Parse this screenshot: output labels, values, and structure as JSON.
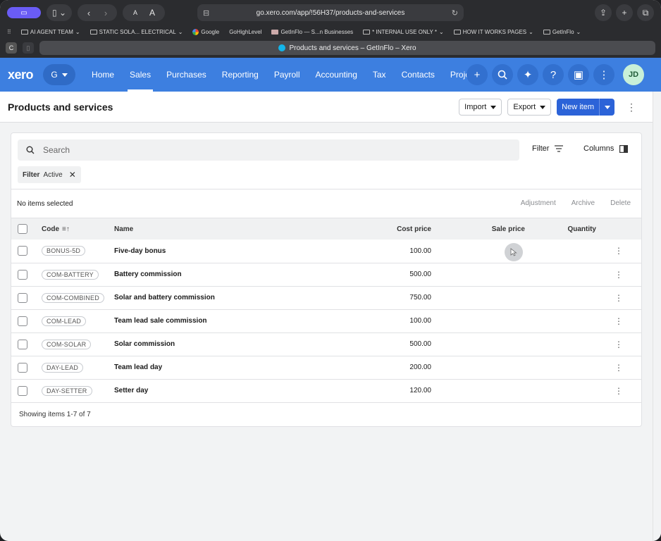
{
  "browser": {
    "url": "go.xero.com/app/!56H37/products-and-services",
    "tab_title": "Products and services – GetInFlo – Xero",
    "tab_badge": "C",
    "bookmarks": [
      {
        "label": "AI AGENT TEAM",
        "type": "folder"
      },
      {
        "label": "STATIC SOLA... ELECTRICAL",
        "type": "folder"
      },
      {
        "label": "Google",
        "type": "google"
      },
      {
        "label": "GoHighLevel",
        "type": "link"
      },
      {
        "label": "GetInFlo — S...n Businesses",
        "type": "link"
      },
      {
        "label": "* INTERNAL USE ONLY *",
        "type": "folder"
      },
      {
        "label": "HOW IT WORKS PAGES",
        "type": "folder"
      },
      {
        "label": "GetInFlo",
        "type": "folder"
      }
    ]
  },
  "xero": {
    "logo": "xero",
    "org_initial": "G",
    "nav": [
      "Home",
      "Sales",
      "Purchases",
      "Reporting",
      "Payroll",
      "Accounting",
      "Tax",
      "Contacts",
      "Projects"
    ],
    "active_nav": "Sales",
    "avatar_initials": "JD"
  },
  "page": {
    "title": "Products and services",
    "import_label": "Import",
    "export_label": "Export",
    "new_item_label": "New item"
  },
  "toolbar": {
    "search_placeholder": "Search",
    "filter_label": "Filter",
    "columns_label": "Columns",
    "chip_key": "Filter",
    "chip_value": "Active"
  },
  "selection": {
    "text": "No items selected",
    "actions": [
      "Adjustment",
      "Archive",
      "Delete"
    ]
  },
  "table": {
    "headers": {
      "code": "Code",
      "name": "Name",
      "cost": "Cost price",
      "sale": "Sale price",
      "qty": "Quantity"
    },
    "rows": [
      {
        "code": "BONUS-5D",
        "name": "Five-day bonus",
        "cost": "100.00",
        "sale": "",
        "qty": ""
      },
      {
        "code": "COM-BATTERY",
        "name": "Battery commission",
        "cost": "500.00",
        "sale": "",
        "qty": ""
      },
      {
        "code": "COM-COMBINED",
        "name": "Solar and battery commission",
        "cost": "750.00",
        "sale": "",
        "qty": ""
      },
      {
        "code": "COM-LEAD",
        "name": "Team lead sale commission",
        "cost": "100.00",
        "sale": "",
        "qty": ""
      },
      {
        "code": "COM-SOLAR",
        "name": "Solar commission",
        "cost": "500.00",
        "sale": "",
        "qty": ""
      },
      {
        "code": "DAY-LEAD",
        "name": "Team lead day",
        "cost": "200.00",
        "sale": "",
        "qty": ""
      },
      {
        "code": "DAY-SETTER",
        "name": "Setter day",
        "cost": "120.00",
        "sale": "",
        "qty": ""
      }
    ],
    "footer": "Showing items 1-7 of 7"
  },
  "colors": {
    "xero_blue": "#3d7fe0",
    "primary_button": "#2c63d8"
  }
}
